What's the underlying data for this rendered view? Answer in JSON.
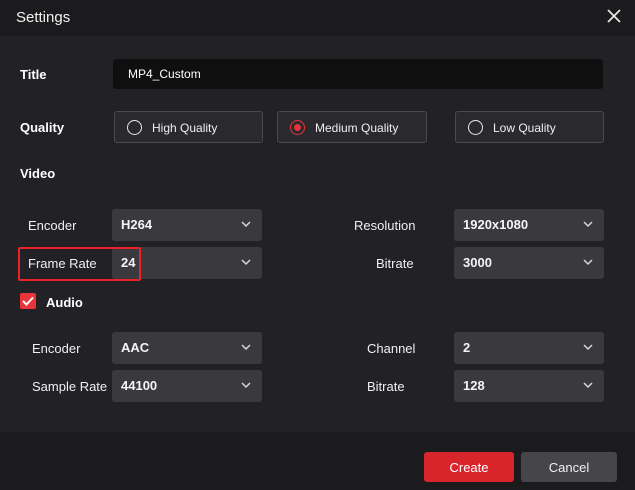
{
  "window": {
    "title": "Settings"
  },
  "title_field": {
    "label": "Title",
    "value": "MP4_Custom"
  },
  "quality": {
    "label": "Quality",
    "options": [
      "High Quality",
      "Medium Quality",
      "Low Quality"
    ],
    "selected": "Medium Quality"
  },
  "video": {
    "heading": "Video",
    "encoder": {
      "label": "Encoder",
      "value": "H264"
    },
    "resolution": {
      "label": "Resolution",
      "value": "1920x1080"
    },
    "frame_rate": {
      "label": "Frame Rate",
      "value": "24"
    },
    "bitrate": {
      "label": "Bitrate",
      "value": "3000"
    }
  },
  "audio": {
    "heading": "Audio",
    "enabled": true,
    "encoder": {
      "label": "Encoder",
      "value": "AAC"
    },
    "channel": {
      "label": "Channel",
      "value": "2"
    },
    "sample_rate": {
      "label": "Sample Rate",
      "value": "44100"
    },
    "bitrate": {
      "label": "Bitrate",
      "value": "128"
    }
  },
  "buttons": {
    "create": "Create",
    "cancel": "Cancel"
  },
  "colors": {
    "accent": "#e8343a",
    "highlight_box": "#e8232a",
    "background": "#222226"
  },
  "icons": {
    "close": "close-icon",
    "dropdown": "chevron-down-icon",
    "check": "checkmark-icon"
  }
}
